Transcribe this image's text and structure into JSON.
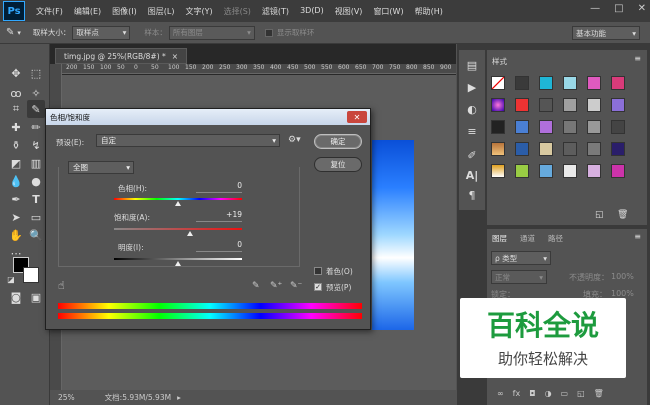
{
  "app": {
    "logo": "Ps"
  },
  "menu": {
    "items": [
      "文件(F)",
      "编辑(E)",
      "图像(I)",
      "图层(L)",
      "文字(Y)",
      "选择(S)",
      "滤镜(T)",
      "3D(D)",
      "视图(V)",
      "窗口(W)",
      "帮助(H)"
    ],
    "dim_items": [
      5
    ]
  },
  "window_controls": [
    "—",
    "□",
    "✕"
  ],
  "options": {
    "sample_size_label": "取样大小：",
    "sample_size_value": "取样点",
    "sample_label": "样本：",
    "sample_value": "所有图层",
    "show_ring": "显示取样环",
    "workspace": "基本功能"
  },
  "document": {
    "tab_title": "timg.jpg @ 25%(RGB/8#) *",
    "close": "×"
  },
  "ruler_ticks": [
    "200",
    "150",
    "100",
    "50",
    "0",
    "50",
    "100",
    "150",
    "200",
    "250",
    "300",
    "350",
    "400",
    "450",
    "500",
    "550",
    "600",
    "650",
    "700",
    "750",
    "800",
    "850",
    "900"
  ],
  "status": {
    "zoom": "25%",
    "doc_size": "文档:5.93M/5.93M"
  },
  "dialog": {
    "title": "色相/饱和度",
    "preset_label": "预设(E):",
    "preset_value": "自定",
    "ok": "确定",
    "reset": "复位",
    "channel": "全图",
    "hue_label": "色相(H):",
    "hue_value": "0",
    "sat_label": "饱和度(A):",
    "sat_value": "+19",
    "light_label": "明度(I):",
    "light_value": "0",
    "colorize_label": "着色(O)",
    "preview_label": "预览(P)",
    "colorize_checked": false,
    "preview_checked": true,
    "hue_level": 0.5,
    "sat_level": 0.595,
    "light_level": 0.5
  },
  "styles_panel": {
    "tab": "样式"
  },
  "layers_panel": {
    "tabs": [
      "图层",
      "通道",
      "路径"
    ],
    "kind": "ρ 类型",
    "blend": "正常",
    "opacity_label": "不透明度：",
    "opacity_value": "100%",
    "lock_label": "锁定：",
    "fill_label": "填充：",
    "fill_value": "100%"
  },
  "watermark": {
    "title": "百科全说",
    "subtitle": "助你轻松解决"
  },
  "colors": {
    "accent": "#31a8ff",
    "fg": "#000000",
    "bg": "#ffffff"
  }
}
